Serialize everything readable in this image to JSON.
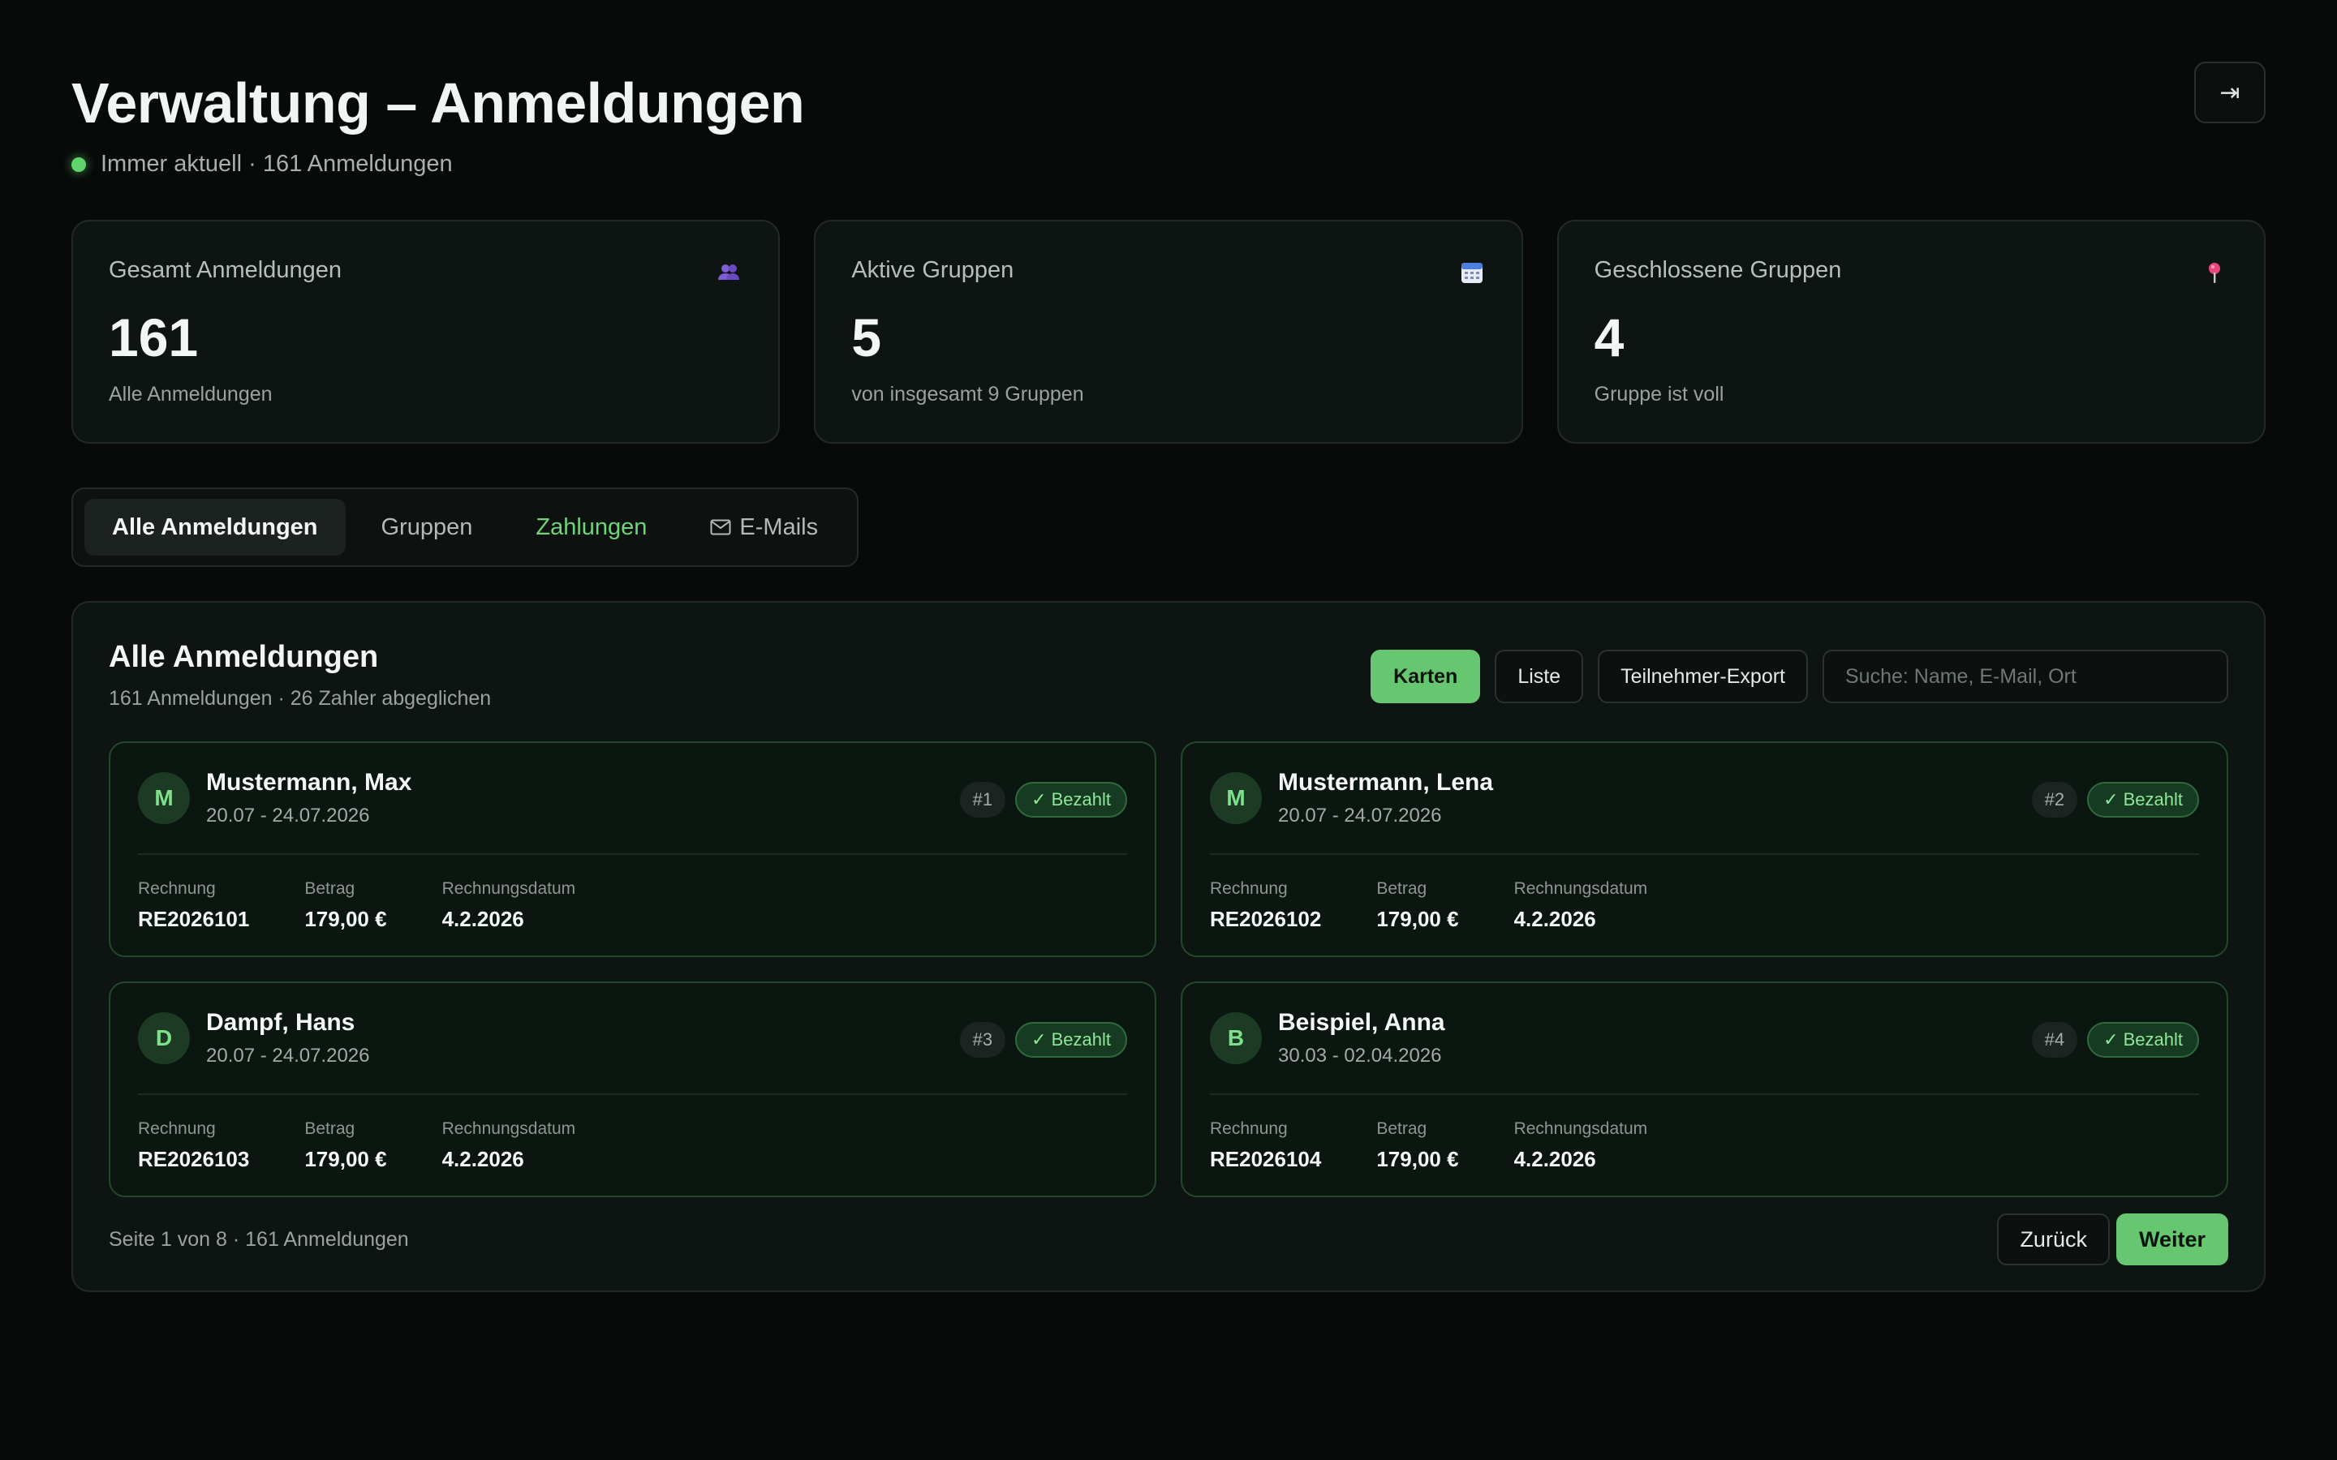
{
  "header": {
    "title": "Verwaltung – Anmeldungen",
    "status": "Immer aktuell · 161 Anmeldungen",
    "logout_glyph": "⇥"
  },
  "stats": [
    {
      "label": "Gesamt Anmeldungen",
      "value": "161",
      "sub": "Alle Anmeldungen",
      "icon": "users-icon"
    },
    {
      "label": "Aktive Gruppen",
      "value": "5",
      "sub": "von insgesamt 9 Gruppen",
      "icon": "calendar-icon"
    },
    {
      "label": "Geschlossene Gruppen",
      "value": "4",
      "sub": "Gruppe ist voll",
      "icon": "pin-icon"
    }
  ],
  "tabs": [
    "Alle Anmeldungen",
    "Gruppen",
    "Zahlungen",
    "E-Mails"
  ],
  "panel": {
    "title": "Alle Anmeldungen",
    "subtitle": "161 Anmeldungen · 26 Zahler abgeglichen",
    "view_cards": "Karten",
    "view_list": "Liste",
    "export": "Teilnehmer-Export",
    "search_placeholder": "Suche: Name, E-Mail, Ort"
  },
  "field_labels": {
    "invoice": "Rechnung",
    "amount": "Betrag",
    "date": "Rechnungsdatum"
  },
  "registrations": [
    {
      "initial": "M",
      "name": "Mustermann, Max",
      "dates": "20.07 - 24.07.2026",
      "num": "#1",
      "status": "✓ Bezahlt",
      "invoice": "RE2026101",
      "amount": "179,00 €",
      "date": "4.2.2026"
    },
    {
      "initial": "M",
      "name": "Mustermann, Lena",
      "dates": "20.07 - 24.07.2026",
      "num": "#2",
      "status": "✓ Bezahlt",
      "invoice": "RE2026102",
      "amount": "179,00 €",
      "date": "4.2.2026"
    },
    {
      "initial": "D",
      "name": "Dampf, Hans",
      "dates": "20.07 - 24.07.2026",
      "num": "#3",
      "status": "✓ Bezahlt",
      "invoice": "RE2026103",
      "amount": "179,00 €",
      "date": "4.2.2026"
    },
    {
      "initial": "B",
      "name": "Beispiel, Anna",
      "dates": "30.03 - 02.04.2026",
      "num": "#4",
      "status": "✓ Bezahlt",
      "invoice": "RE2026104",
      "amount": "179,00 €",
      "date": "4.2.2026"
    }
  ],
  "pager": {
    "text": "Seite 1 von 8 · 161 Anmeldungen",
    "prev": "Zurück",
    "next": "Weiter"
  },
  "colors": {
    "accent": "#66c770",
    "background": "#080a09",
    "card": "#0e1412"
  }
}
